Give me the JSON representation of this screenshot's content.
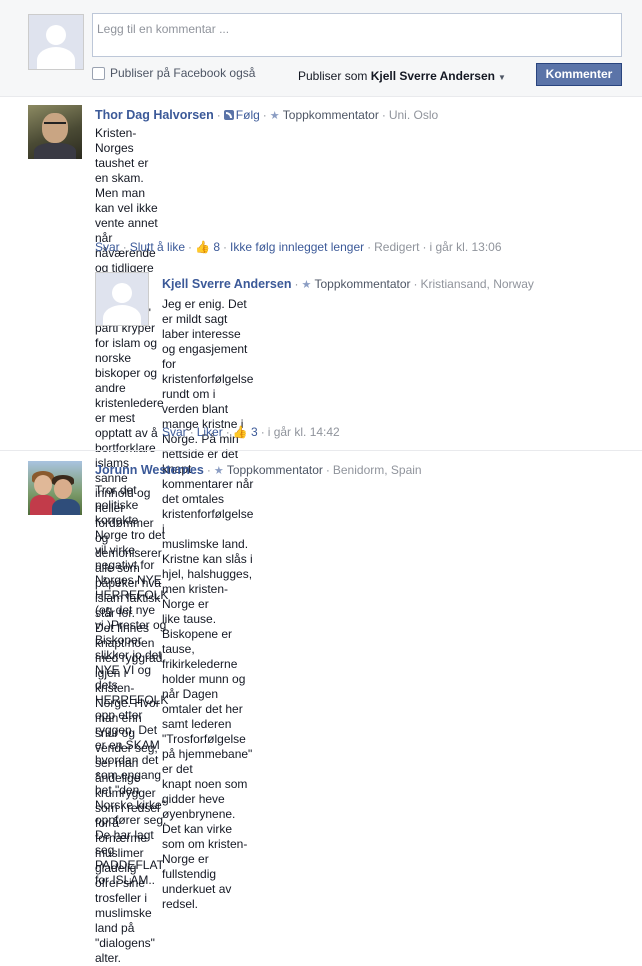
{
  "composer": {
    "placeholder": "Legg til en kommentar ...",
    "facebook_checkbox_label": "Publiser på Facebook også",
    "post_as_prefix": "Publiser som",
    "post_as_name": "Kjell Sverre Andersen",
    "submit_label": "Kommenter"
  },
  "comments": [
    {
      "author": "Thor Dag Halvorsen",
      "follow_label": "Følg",
      "badge": "Toppkommentator",
      "location": "Uni. Oslo",
      "text": [
        "Kristen-Norges taushet er en skam. Men man kan vel ikke vente annet når nåværende",
        "og tidligere ledere for landets \"kristelige\" parti kryper for islam og norske biskoper og",
        "andre kristenledere er mest opptatt av å bortforklare islams sanne innhold og heller",
        "fordømmer og demoniserer alle som påpeker hva islam faktisk står for.",
        "Det finnes knapt noen med ryggrad igjen i kristen-Norge. Hvor man enn snur og",
        "vender seg, ser man åndelige krumrygger som i redsel for å fornærme muslimer",
        "gladelig ofrer sine trosfeller i muslimske land på \"dialogens\" alter."
      ],
      "actions": {
        "reply": "Svar",
        "unlike": "Slutt å like",
        "like_count": "8",
        "unfollow": "Ikke følg innlegget lenger",
        "edited": "Redigert",
        "timestamp": "i går kl. 13:06"
      }
    },
    {
      "author": "Kjell Sverre Andersen",
      "badge": "Toppkommentator",
      "location": "Kristiansand, Norway",
      "text": [
        "Jeg er enig. Det er mildt sagt laber interesse og engasjement for",
        "kristenforfølgelse rundt om i verden blant mange kristne i Norge. På min",
        "nettside er det knapt kommentarer når det omtales kristenforfølgelse i",
        "muslimske land. Kristne kan slås i hjel, halshugges, men kristen-Norge er",
        "like tause. Biskopene er tause, frikirkelederne holder munn og når Dagen",
        "omtaler det her samt lederen \"Trosforfølgelse på hjemmebane\" er det",
        "knapt noen som gidder heve øyenbrynene. Det kan virke som om kristen-",
        "Norge er fullstendig underkuet av redsel."
      ],
      "actions": {
        "reply": "Svar",
        "like": "Liker",
        "like_count": "3",
        "timestamp": "i går kl. 14:42"
      }
    },
    {
      "author": "Jorunn Westernes",
      "badge": "Toppkommentator",
      "location": "Benidorm, Spain",
      "text": [
        "Tror det politiske korrekte Norge tro det vil virke negativt for Norges NYE HERREFOLK",
        "(og det nye vi.)Prester og Biskoper slikker jo det NYE VI og dets HERREFOLK opp etter",
        "ryggen. Det er en SKAM hvordan det som engang het \"den Norske kirke\" oppfører seg.",
        "De har lagt seg PADDEFLAT for ISLAM.."
      ]
    }
  ]
}
